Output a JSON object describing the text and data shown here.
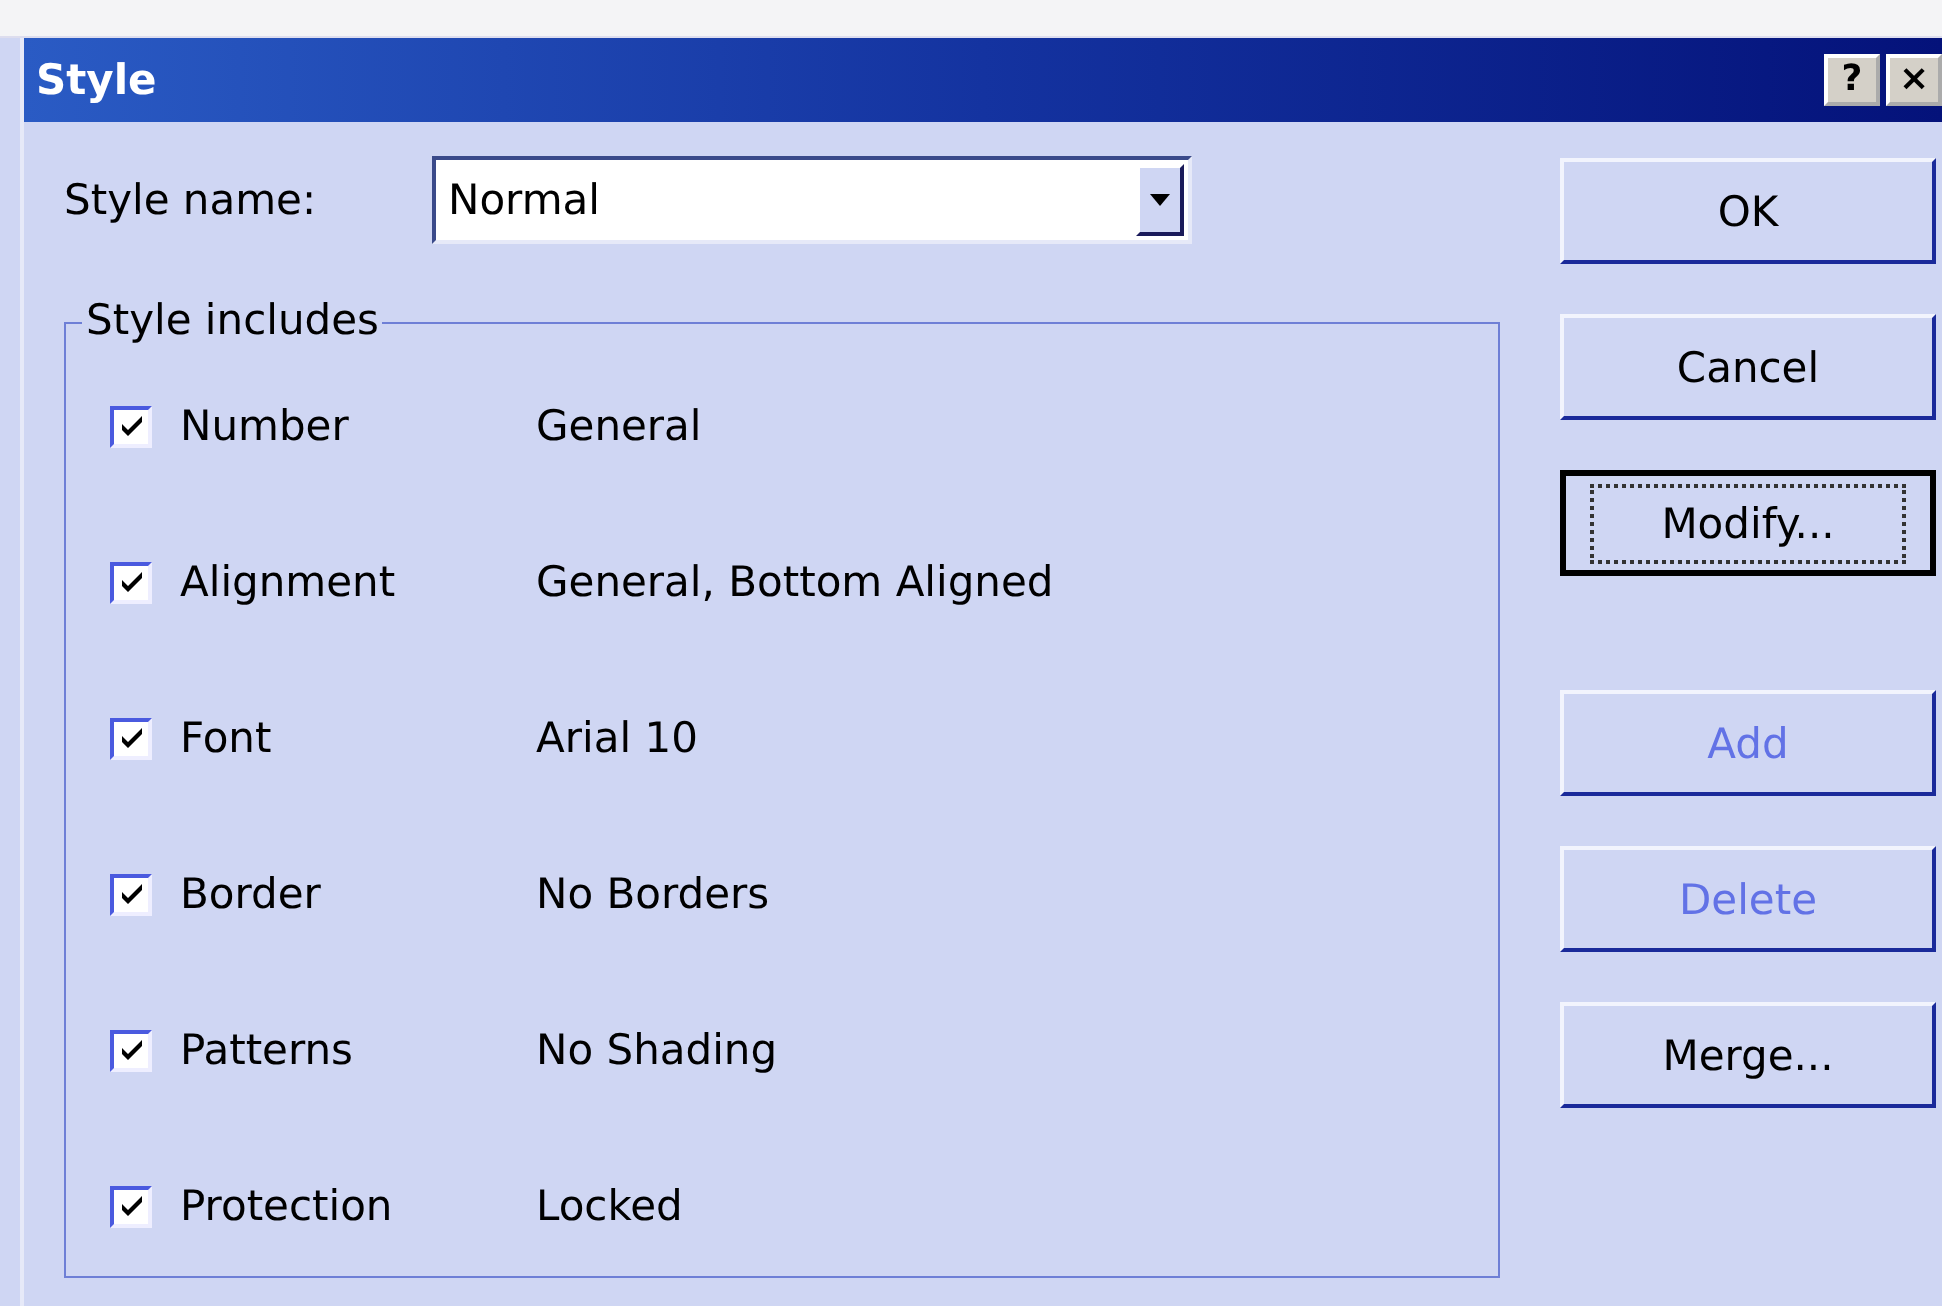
{
  "window": {
    "title": "Style",
    "help_button": "?",
    "close_button": "×"
  },
  "style_name": {
    "label": "Style name:",
    "value": "Normal"
  },
  "group": {
    "title": "Style includes",
    "items": [
      {
        "label": "Number",
        "value": "General",
        "checked": true
      },
      {
        "label": "Alignment",
        "value": "General, Bottom Aligned",
        "checked": true
      },
      {
        "label": "Font",
        "value": "Arial 10",
        "checked": true
      },
      {
        "label": "Border",
        "value": "No Borders",
        "checked": true
      },
      {
        "label": "Patterns",
        "value": "No Shading",
        "checked": true
      },
      {
        "label": "Protection",
        "value": "Locked",
        "checked": true
      }
    ]
  },
  "buttons": [
    {
      "label": "OK",
      "disabled": false,
      "default": false
    },
    {
      "label": "Cancel",
      "disabled": false,
      "default": false
    },
    {
      "label": "Modify...",
      "disabled": false,
      "default": true
    },
    {
      "label": "Add",
      "disabled": true,
      "default": false
    },
    {
      "label": "Delete",
      "disabled": true,
      "default": false
    },
    {
      "label": "Merge...",
      "disabled": false,
      "default": false
    }
  ]
}
